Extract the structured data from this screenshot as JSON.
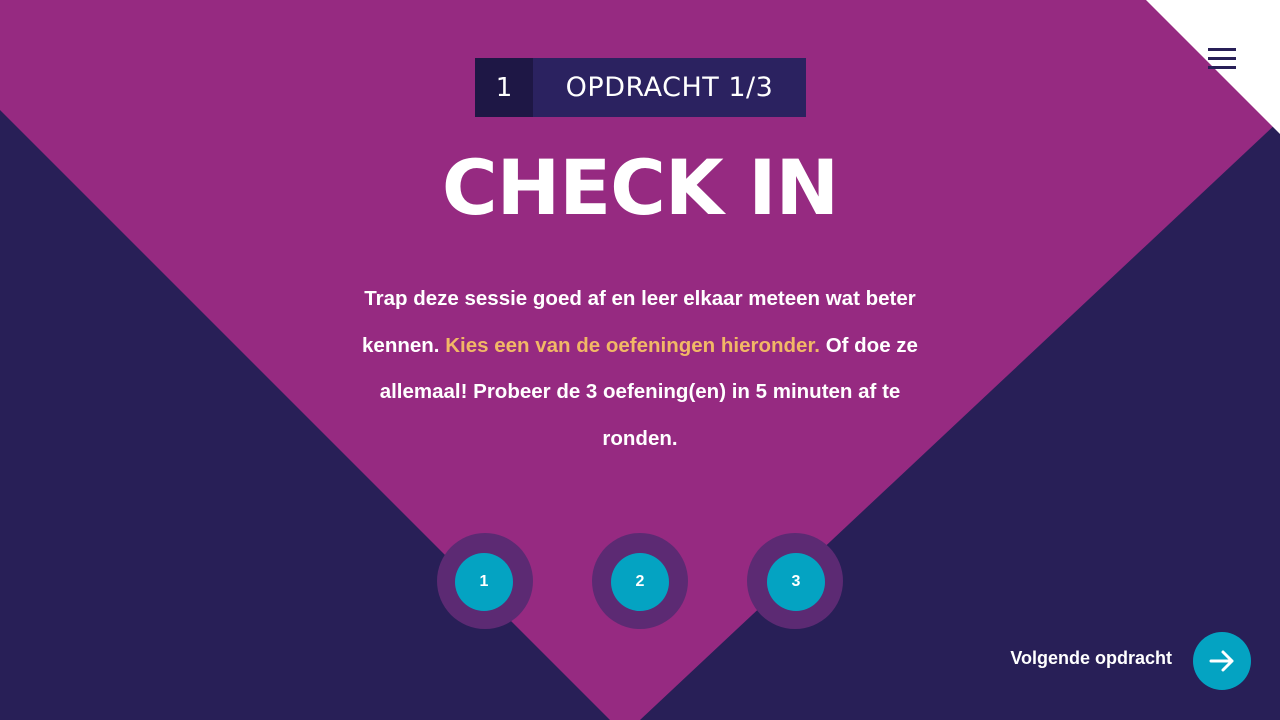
{
  "assignment_badge": {
    "number": "1",
    "label": "OPDRACHT 1/3"
  },
  "title": "CHECK IN",
  "intro": {
    "text_before": "Trap deze sessie goed af en leer elkaar meteen wat beter kennen. ",
    "highlight": "Kies een van de oefeningen hieronder.",
    "text_after": " Of doe ze allemaal! Probeer de 3 oefening(en) in 5 minuten af te ronden."
  },
  "exercises": [
    {
      "label": "1"
    },
    {
      "label": "2"
    },
    {
      "label": "3"
    }
  ],
  "next": {
    "label": "Volgende opdracht"
  },
  "icons": {
    "menu": "hamburger-menu-icon",
    "next": "arrow-right-icon"
  },
  "colors": {
    "background_dark": "#281f57",
    "magenta": "#962a81",
    "accent_cyan": "#04a3c2",
    "highlight_orange": "#f2b866",
    "corner_white": "#ffffff"
  }
}
